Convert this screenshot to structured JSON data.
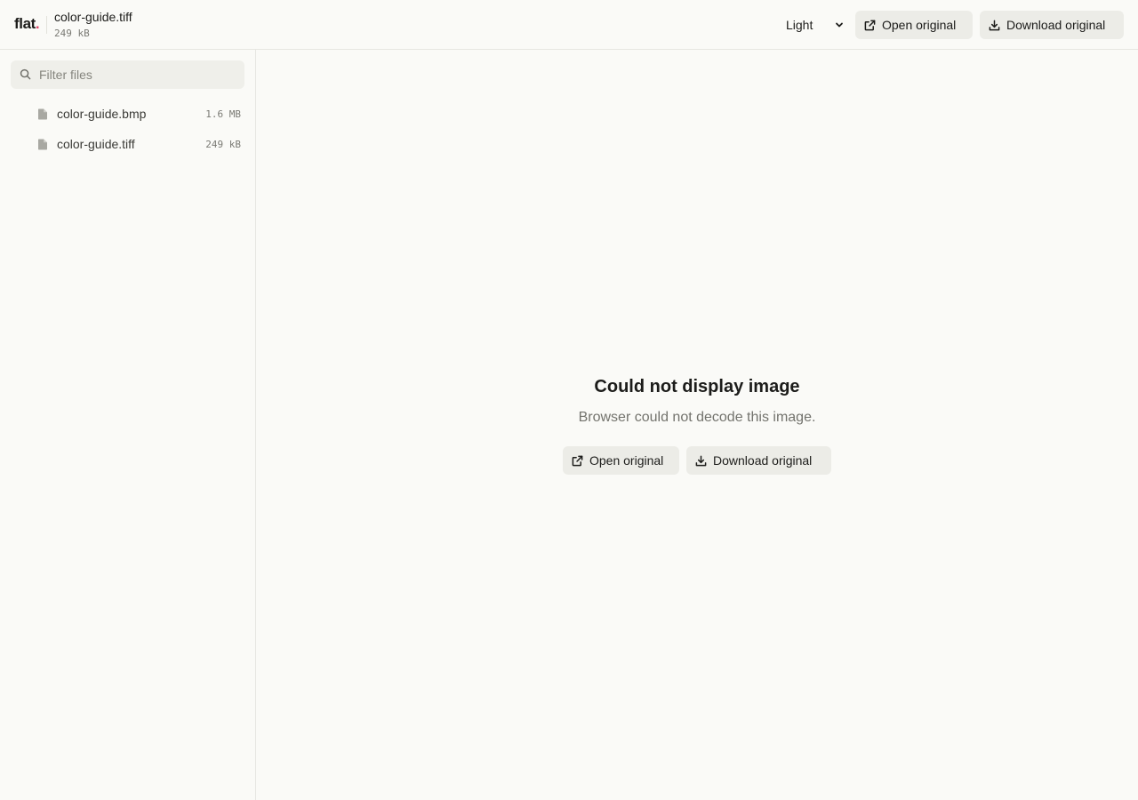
{
  "app": {
    "logo_text": "flat",
    "logo_dot": ".",
    "accent_color": "#e0456a"
  },
  "header": {
    "file_name": "color-guide.tiff",
    "file_size": "249 kB",
    "theme_select": {
      "value": "Light",
      "icon": "chevron-down-icon"
    },
    "open_button": {
      "label": "Open original",
      "icon": "external-link-icon"
    },
    "download_button": {
      "label": "Download original",
      "icon": "download-icon"
    }
  },
  "sidebar": {
    "search": {
      "placeholder": "Filter files",
      "value": "",
      "icon": "search-icon"
    },
    "files": [
      {
        "name": "color-guide.bmp",
        "size": "1.6 MB",
        "icon": "file-icon"
      },
      {
        "name": "color-guide.tiff",
        "size": "249 kB",
        "icon": "file-icon"
      }
    ]
  },
  "main": {
    "error_title": "Could not display image",
    "error_description": "Browser could not decode this image.",
    "open_button": {
      "label": "Open original",
      "icon": "external-link-icon"
    },
    "download_button": {
      "label": "Download original",
      "icon": "download-icon"
    }
  }
}
